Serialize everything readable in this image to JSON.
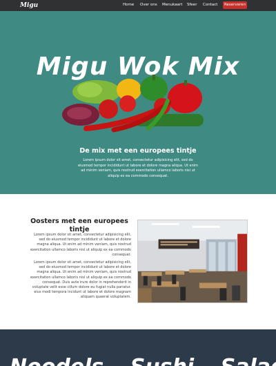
{
  "navbar": {
    "brand": "Migu",
    "items": [
      "Home",
      "Over ons",
      "Menukaart",
      "Sfeer",
      "Contact"
    ],
    "reserve_label": "Reserveren",
    "reserve_color": "#c7312b"
  },
  "hero": {
    "title": "Migu Wok Mix",
    "subtitle": "De mix met een europees tintje",
    "text": "Lorem ipsum dolor sit amet, consectetur adipisicing elit, sed do eiusmod tempor incididunt ut labore et dolore magna aliqua. Ut enim ad minim veniam, quis nostrud exercitation ullamco laboris nisi ut aliquip ex ea commodo consequat.",
    "background": "#3f8a82"
  },
  "about": {
    "title": "Oosters met een europees tintje",
    "p1": "Lorem ipsum dolor sit amet, consectetur adipisicing elit, sed do eiusmod tempor incididunt ut labore et dolore magna aliqua. Ut enim ad minim veniam, quis nostrud exercitation ullamco laboris nisi ut aliquip ex ea commodo consequat.",
    "p2": "Lorem ipsum dolor sit amet, consectetur adipisicing elit, sed do eiusmod tempor incididunt ut labore et dolore magna aliqua. Ut enim ad minim veniam, quis nostrud exercitation ullamco laboris nisi ut aliquip ex ea commodo consequat. Duis aute irure dolor in reprehenderit in voluptate velit esse cillum dolore eu fugiat nulla pariatur. eius modi tempora incidunt ut labore et dolore magnam aliquam quaerat voluptatem."
  },
  "bottom": {
    "words": [
      "Noodels",
      "Sushi",
      "Salades"
    ],
    "background": "#2c3a4a"
  }
}
